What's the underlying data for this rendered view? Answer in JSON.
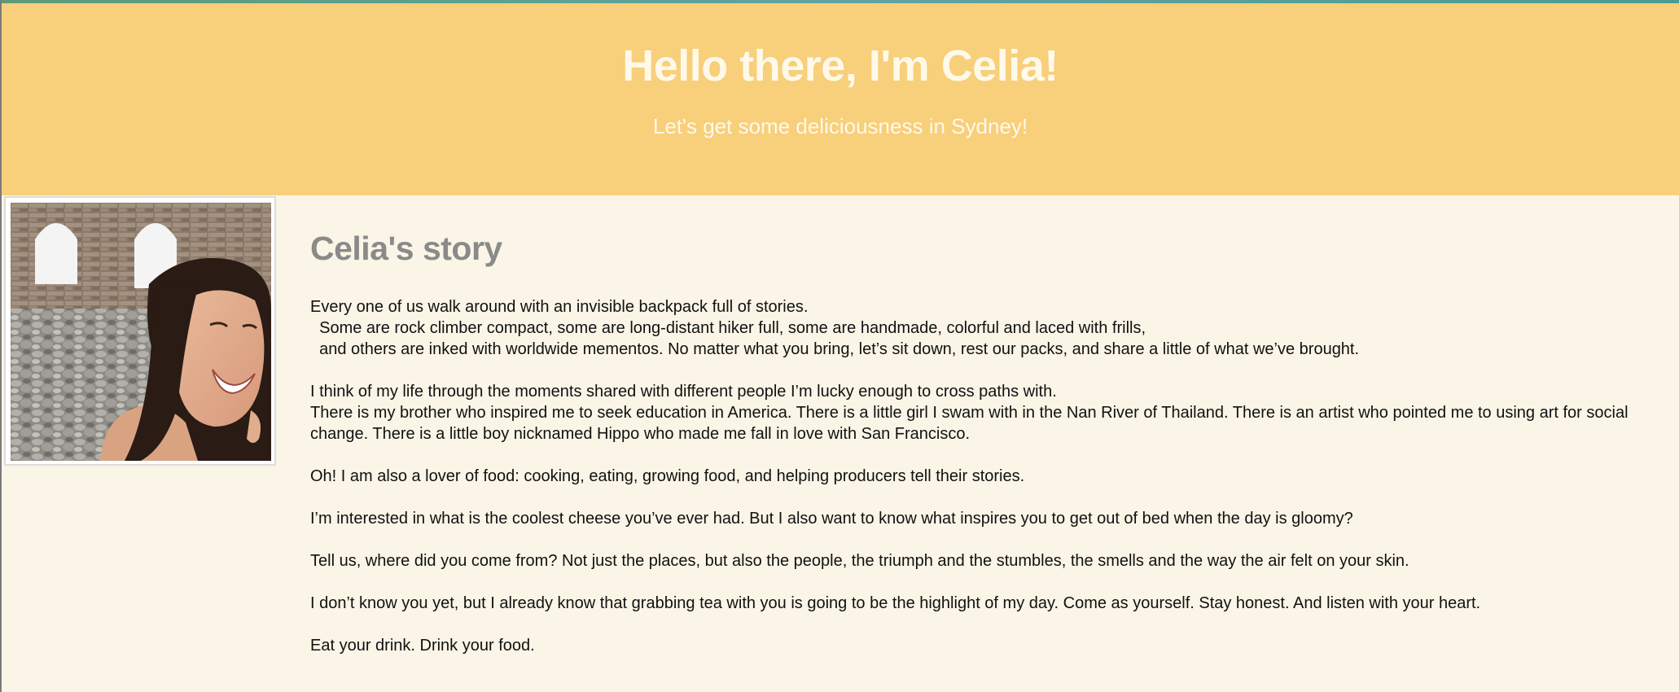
{
  "hero": {
    "title": "Hello there, I'm Celia!",
    "subtitle": "Let's get some deliciousness in Sydney!"
  },
  "colors": {
    "hero_background": "#f8cf7a",
    "page_background": "#faf5e6",
    "hero_text": "#fff9ea",
    "story_title": "#8a8a8a",
    "body_text": "#111111"
  },
  "photo": {
    "alt": "Celia"
  },
  "story": {
    "title": "Celia's story",
    "p1_l1": "Every one of us walk around with an invisible backpack full of stories.",
    "p1_l2": "  Some are rock climber compact, some are long-distant hiker full, some are handmade, colorful and laced with frills,",
    "p1_l3": "  and others are inked with worldwide mementos. No matter what you bring, let’s sit down, rest our packs, and share a little of what we’ve brought.",
    "p2_l1": "I think of my life through the moments shared with different people I’m lucky enough to cross paths with.",
    "p2_l2": "There is my brother who inspired me to seek education in America. There is a little girl I swam with in the Nan River of Thailand. There is an artist who pointed me to using art for social change. There is a little boy nicknamed Hippo who made me fall in love with San Francisco.",
    "p3": "Oh! I am also a lover of food: cooking, eating, growing food, and helping producers tell their stories.",
    "p4": "I’m interested in what is the coolest cheese you’ve ever had. But I also want to know what inspires you to get out of bed when the day is gloomy?",
    "p5": "Tell us, where did you come from? Not just the places, but also the people, the triumph and the stumbles, the smells and the way the air felt on your skin.",
    "p6": "I don’t know you yet, but I already know that grabbing tea with you is going to be the highlight of my day. Come as yourself. Stay honest. And listen with your heart.",
    "p7": "Eat your drink. Drink your food."
  }
}
